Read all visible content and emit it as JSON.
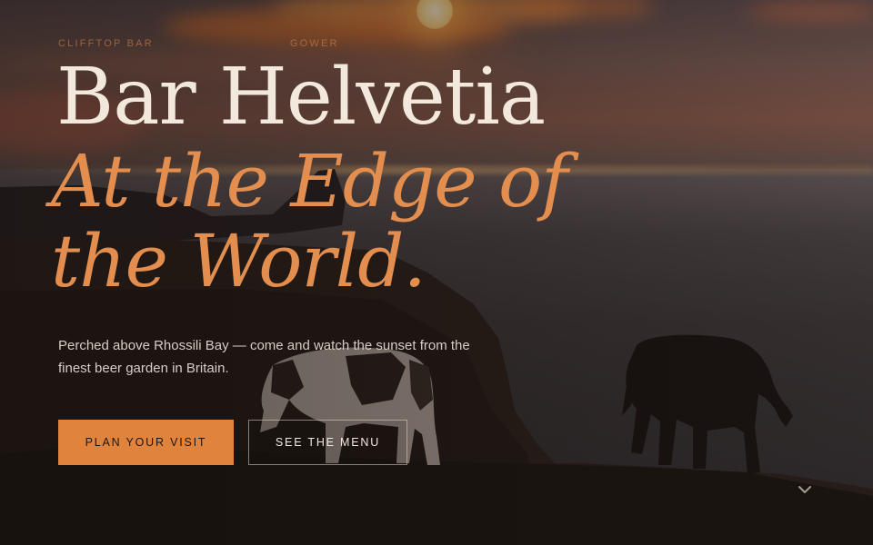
{
  "hero": {
    "eyebrow_left": "Clifftop Bar",
    "eyebrow_right": "Gower",
    "title": "Bar Helvetia",
    "tagline_line1": "At the Edge of",
    "tagline_line2": "the World.",
    "description": "Perched above Rhossili Bay — come and watch the sunset from the finest beer garden in Britain."
  },
  "actions": {
    "primary_label": "Plan Your Visit",
    "secondary_label": "See the Menu"
  },
  "scroll_hint": {
    "icon": "chevron-down-icon"
  },
  "colors": {
    "accent": "#e0833c",
    "title": "#f3e8dc",
    "tagline": "#e38d4e",
    "body": "#d6cdc4"
  }
}
